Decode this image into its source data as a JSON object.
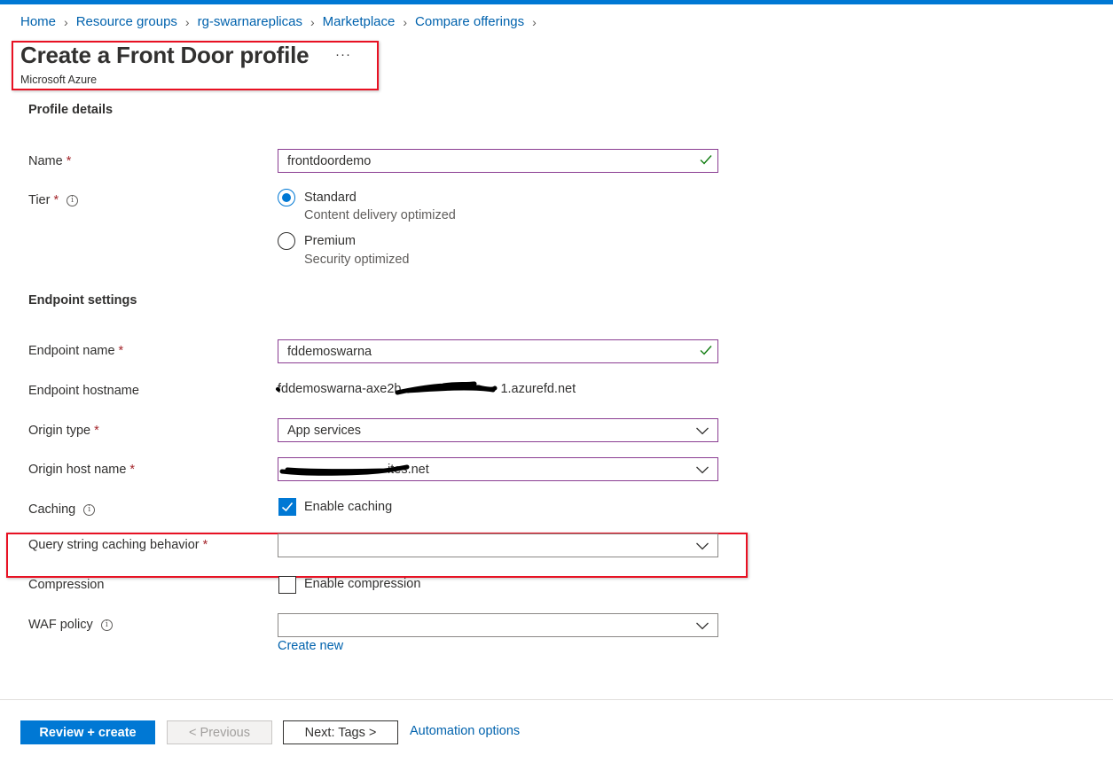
{
  "breadcrumb": [
    "Home",
    "Resource groups",
    "rg-swarnareplicas",
    "Marketplace",
    "Compare offerings"
  ],
  "header": {
    "title": "Create a Front Door profile",
    "more_label": "···",
    "subtitle": "Microsoft Azure"
  },
  "profile": {
    "section_title": "Profile details",
    "name_label": "Name",
    "name_value": "frontdoordemo",
    "tier_label": "Tier",
    "tiers": [
      {
        "label": "Standard",
        "desc": "Content delivery optimized",
        "selected": true
      },
      {
        "label": "Premium",
        "desc": "Security optimized",
        "selected": false
      }
    ]
  },
  "endpoint": {
    "section_title": "Endpoint settings",
    "endpoint_name_label": "Endpoint name",
    "endpoint_name_value": "fddemoswarna",
    "hostname_label": "Endpoint hostname",
    "hostname_visible_prefix": "fddemoswarna-axe2b",
    "hostname_visible_suffix": "1.azurefd.net",
    "origin_type_label": "Origin type",
    "origin_type_value": "App services",
    "origin_host_label": "Origin host name",
    "origin_host_visible_suffix": "ites.net",
    "caching_label": "Caching",
    "caching_checkbox_label": "Enable caching",
    "caching_checked": true,
    "query_label": "Query string caching behavior",
    "query_value": "",
    "compression_label": "Compression",
    "compression_checkbox_label": "Enable compression",
    "compression_checked": false,
    "waf_label": "WAF policy",
    "waf_value": "",
    "create_new_label": "Create new"
  },
  "footer": {
    "review_create": "Review + create",
    "previous": "< Previous",
    "next": "Next: Tags >",
    "automation": "Automation options"
  },
  "colors": {
    "accent": "#0078d4",
    "required": "#a4262c",
    "highlight": "#e81123",
    "valid": "#107c10"
  }
}
